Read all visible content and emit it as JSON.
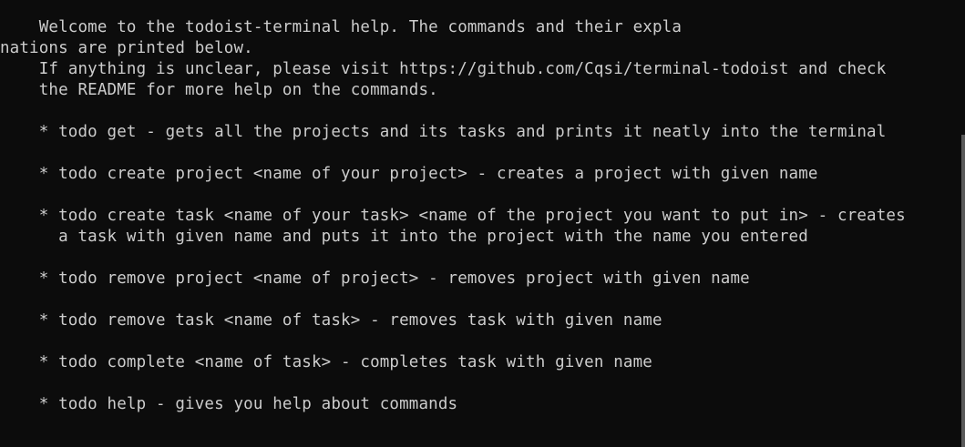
{
  "colors": {
    "background": "#0c0c0c",
    "foreground": "#cccccc",
    "scrollbar_thumb": "#5a5a5a"
  },
  "terminal": {
    "lines": [
      "    Welcome to the todoist-terminal help. The commands and their expla",
      "nations are printed below.",
      "    If anything is unclear, please visit https://github.com/Cqsi/terminal-todoist and check",
      "    the README for more help on the commands.",
      "",
      "    * todo get - gets all the projects and its tasks and prints it neatly into the terminal",
      "",
      "    * todo create project <name of your project> - creates a project with given name",
      "",
      "    * todo create task <name of your task> <name of the project you want to put in> - creates",
      "      a task with given name and puts it into the project with the name you entered",
      "",
      "    * todo remove project <name of project> - removes project with given name",
      "",
      "    * todo remove task <name of task> - removes task with given name",
      "",
      "    * todo complete <name of task> - completes task with given name",
      "",
      "    * todo help - gives you help about commands"
    ]
  }
}
